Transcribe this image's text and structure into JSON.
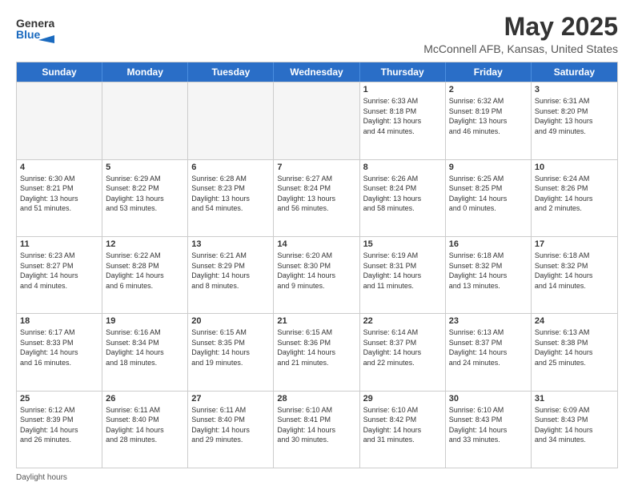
{
  "header": {
    "logo_line1": "General",
    "logo_line2": "Blue",
    "month": "May 2025",
    "location": "McConnell AFB, Kansas, United States"
  },
  "weekdays": [
    "Sunday",
    "Monday",
    "Tuesday",
    "Wednesday",
    "Thursday",
    "Friday",
    "Saturday"
  ],
  "rows": [
    [
      {
        "day": "",
        "info": "",
        "empty": true
      },
      {
        "day": "",
        "info": "",
        "empty": true
      },
      {
        "day": "",
        "info": "",
        "empty": true
      },
      {
        "day": "",
        "info": "",
        "empty": true
      },
      {
        "day": "1",
        "info": "Sunrise: 6:33 AM\nSunset: 8:18 PM\nDaylight: 13 hours\nand 44 minutes.",
        "empty": false
      },
      {
        "day": "2",
        "info": "Sunrise: 6:32 AM\nSunset: 8:19 PM\nDaylight: 13 hours\nand 46 minutes.",
        "empty": false
      },
      {
        "day": "3",
        "info": "Sunrise: 6:31 AM\nSunset: 8:20 PM\nDaylight: 13 hours\nand 49 minutes.",
        "empty": false
      }
    ],
    [
      {
        "day": "4",
        "info": "Sunrise: 6:30 AM\nSunset: 8:21 PM\nDaylight: 13 hours\nand 51 minutes.",
        "empty": false
      },
      {
        "day": "5",
        "info": "Sunrise: 6:29 AM\nSunset: 8:22 PM\nDaylight: 13 hours\nand 53 minutes.",
        "empty": false
      },
      {
        "day": "6",
        "info": "Sunrise: 6:28 AM\nSunset: 8:23 PM\nDaylight: 13 hours\nand 54 minutes.",
        "empty": false
      },
      {
        "day": "7",
        "info": "Sunrise: 6:27 AM\nSunset: 8:24 PM\nDaylight: 13 hours\nand 56 minutes.",
        "empty": false
      },
      {
        "day": "8",
        "info": "Sunrise: 6:26 AM\nSunset: 8:24 PM\nDaylight: 13 hours\nand 58 minutes.",
        "empty": false
      },
      {
        "day": "9",
        "info": "Sunrise: 6:25 AM\nSunset: 8:25 PM\nDaylight: 14 hours\nand 0 minutes.",
        "empty": false
      },
      {
        "day": "10",
        "info": "Sunrise: 6:24 AM\nSunset: 8:26 PM\nDaylight: 14 hours\nand 2 minutes.",
        "empty": false
      }
    ],
    [
      {
        "day": "11",
        "info": "Sunrise: 6:23 AM\nSunset: 8:27 PM\nDaylight: 14 hours\nand 4 minutes.",
        "empty": false
      },
      {
        "day": "12",
        "info": "Sunrise: 6:22 AM\nSunset: 8:28 PM\nDaylight: 14 hours\nand 6 minutes.",
        "empty": false
      },
      {
        "day": "13",
        "info": "Sunrise: 6:21 AM\nSunset: 8:29 PM\nDaylight: 14 hours\nand 8 minutes.",
        "empty": false
      },
      {
        "day": "14",
        "info": "Sunrise: 6:20 AM\nSunset: 8:30 PM\nDaylight: 14 hours\nand 9 minutes.",
        "empty": false
      },
      {
        "day": "15",
        "info": "Sunrise: 6:19 AM\nSunset: 8:31 PM\nDaylight: 14 hours\nand 11 minutes.",
        "empty": false
      },
      {
        "day": "16",
        "info": "Sunrise: 6:18 AM\nSunset: 8:32 PM\nDaylight: 14 hours\nand 13 minutes.",
        "empty": false
      },
      {
        "day": "17",
        "info": "Sunrise: 6:18 AM\nSunset: 8:32 PM\nDaylight: 14 hours\nand 14 minutes.",
        "empty": false
      }
    ],
    [
      {
        "day": "18",
        "info": "Sunrise: 6:17 AM\nSunset: 8:33 PM\nDaylight: 14 hours\nand 16 minutes.",
        "empty": false
      },
      {
        "day": "19",
        "info": "Sunrise: 6:16 AM\nSunset: 8:34 PM\nDaylight: 14 hours\nand 18 minutes.",
        "empty": false
      },
      {
        "day": "20",
        "info": "Sunrise: 6:15 AM\nSunset: 8:35 PM\nDaylight: 14 hours\nand 19 minutes.",
        "empty": false
      },
      {
        "day": "21",
        "info": "Sunrise: 6:15 AM\nSunset: 8:36 PM\nDaylight: 14 hours\nand 21 minutes.",
        "empty": false
      },
      {
        "day": "22",
        "info": "Sunrise: 6:14 AM\nSunset: 8:37 PM\nDaylight: 14 hours\nand 22 minutes.",
        "empty": false
      },
      {
        "day": "23",
        "info": "Sunrise: 6:13 AM\nSunset: 8:37 PM\nDaylight: 14 hours\nand 24 minutes.",
        "empty": false
      },
      {
        "day": "24",
        "info": "Sunrise: 6:13 AM\nSunset: 8:38 PM\nDaylight: 14 hours\nand 25 minutes.",
        "empty": false
      }
    ],
    [
      {
        "day": "25",
        "info": "Sunrise: 6:12 AM\nSunset: 8:39 PM\nDaylight: 14 hours\nand 26 minutes.",
        "empty": false
      },
      {
        "day": "26",
        "info": "Sunrise: 6:11 AM\nSunset: 8:40 PM\nDaylight: 14 hours\nand 28 minutes.",
        "empty": false
      },
      {
        "day": "27",
        "info": "Sunrise: 6:11 AM\nSunset: 8:40 PM\nDaylight: 14 hours\nand 29 minutes.",
        "empty": false
      },
      {
        "day": "28",
        "info": "Sunrise: 6:10 AM\nSunset: 8:41 PM\nDaylight: 14 hours\nand 30 minutes.",
        "empty": false
      },
      {
        "day": "29",
        "info": "Sunrise: 6:10 AM\nSunset: 8:42 PM\nDaylight: 14 hours\nand 31 minutes.",
        "empty": false
      },
      {
        "day": "30",
        "info": "Sunrise: 6:10 AM\nSunset: 8:43 PM\nDaylight: 14 hours\nand 33 minutes.",
        "empty": false
      },
      {
        "day": "31",
        "info": "Sunrise: 6:09 AM\nSunset: 8:43 PM\nDaylight: 14 hours\nand 34 minutes.",
        "empty": false
      }
    ]
  ],
  "footer": {
    "text": "Daylight hours"
  }
}
